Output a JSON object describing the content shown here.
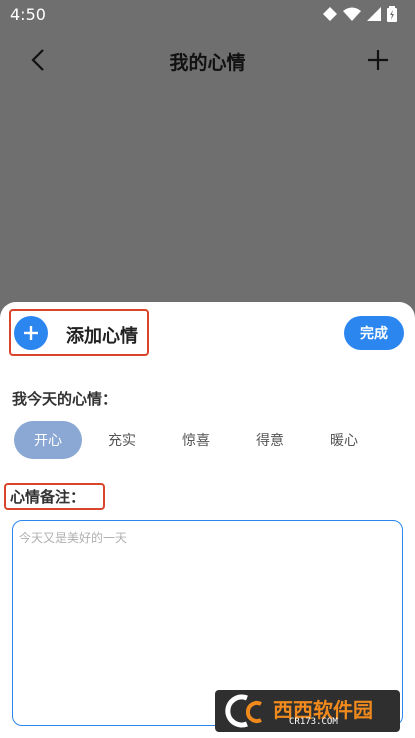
{
  "status_bar": {
    "time": "4:50"
  },
  "app_bar": {
    "title": "我的心情"
  },
  "sheet": {
    "title": "添加心情",
    "done_label": "完成",
    "mood_label": "我今天的心情：",
    "moods": [
      {
        "label": "开心",
        "selected": true
      },
      {
        "label": "充实",
        "selected": false
      },
      {
        "label": "惊喜",
        "selected": false
      },
      {
        "label": "得意",
        "selected": false
      },
      {
        "label": "暖心",
        "selected": false
      }
    ],
    "note_label": "心情备注：",
    "note_placeholder": "今天又是美好的一天",
    "note_value": ""
  },
  "watermark": {
    "brand": "西西软件园",
    "site": "CR173.COM"
  },
  "colors": {
    "accent": "#2b86f0",
    "selected_chip": "#8ba8d4",
    "highlight_box": "#d9452b",
    "dim_overlay": "#6f6f6f"
  }
}
